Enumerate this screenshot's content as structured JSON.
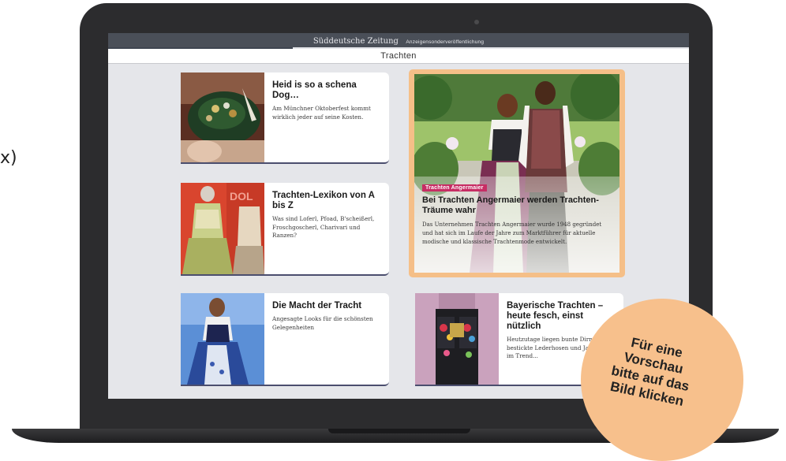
{
  "edge_fragment": "x)",
  "site": {
    "brand": "Süddeutsche Zeitung",
    "subtitle": "Anzeigensonderveröffentlichung",
    "section_tab": "Trachten"
  },
  "cards": [
    {
      "title": "Heid is so a schena Dog…",
      "teaser": "Am Münchner Oktoberfest kommt wirklich jeder auf seine Kosten.",
      "image": "oktoberfest-hat-photo"
    },
    {
      "title": "Trachten-Lexikon von A bis Z",
      "teaser": "Was sind Loferl, Pfoad, B'scheißerl, Froschgoscherl, Charivari und Ranzen?",
      "image": "dirndl-mannequin-photo"
    },
    {
      "title": "Die Macht der Tracht",
      "teaser": "Angesagte Looks für die schönsten Gelegenheiten",
      "image": "woman-dirndl-sky-photo"
    },
    {
      "title": "Bayerische Trachten – heute fesch, einst nützlich",
      "teaser": "Heutzutage liegen bunte Dirn... bestickte Lederhosen und Jancker voll im Trend...",
      "image": "embroidered-vest-photo"
    }
  ],
  "feature": {
    "badge": "Trachten Angermaier",
    "title": "Bei Trachten Angermaier werden Trachten-Träume wahr",
    "lead": "Das Unternehmen Trachten Angermaier wurde 1948 gegründet und hat sich im Laufe der Jahre zum Marktführer für aktuelle modische und klassische Trachtenmode entwickelt.",
    "image": "couple-in-tracht-garden-photo"
  },
  "preview_badge": {
    "lines": [
      "Für eine",
      "Vorschau",
      "bitte auf das",
      "Bild klicken"
    ]
  },
  "colors": {
    "laptop": "#2c2c2e",
    "screen_bg": "#e5e6ea",
    "topbar": "#4a4f58",
    "feature_frame": "#f5bf88",
    "badge": "#c72d64",
    "circle": "#f7c08c"
  }
}
